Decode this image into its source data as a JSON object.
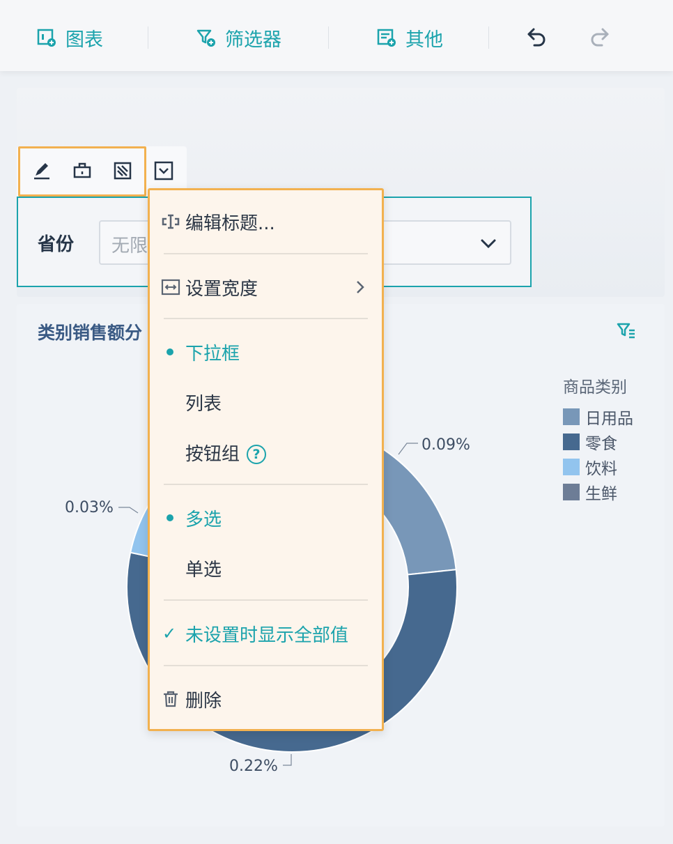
{
  "toolbar": {
    "chart_label": "图表",
    "filter_label": "筛选器",
    "other_label": "其他"
  },
  "filter": {
    "label": "省份",
    "placeholder": "无限"
  },
  "chart": {
    "title": "类别销售额分"
  },
  "menu": {
    "edit_title": "编辑标题...",
    "set_width": "设置宽度",
    "dropdown": "下拉框",
    "list": "列表",
    "button_group": "按钮组",
    "help_mark": "?",
    "multi_select": "多选",
    "single_select": "单选",
    "show_all": "未设置时显示全部值",
    "delete": "删除"
  },
  "chart_data": {
    "type": "pie",
    "legend_title": "商品类别",
    "categories": [
      "日用品",
      "零食",
      "饮料",
      "生鲜"
    ],
    "colors": [
      "#7897b8",
      "#46698f",
      "#92c4ee",
      "#6d7d96"
    ],
    "visible_labels": [
      "0.09%",
      "0.03%",
      "0.22%"
    ]
  },
  "colors": {
    "accent": "#1ba3ac",
    "highlight": "#f2b14f"
  }
}
